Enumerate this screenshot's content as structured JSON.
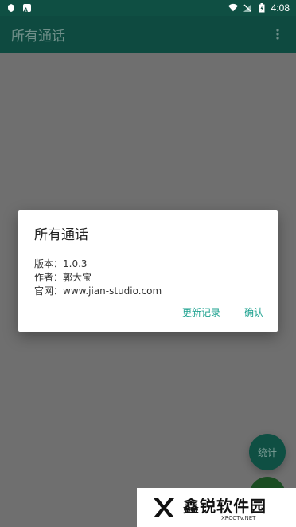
{
  "status_bar": {
    "time": "4:08",
    "left_icons": [
      "shield-icon",
      "a-icon"
    ],
    "right_icons": [
      "wifi-icon",
      "no-signal-icon",
      "battery-icon"
    ]
  },
  "app_bar": {
    "title": "所有通话",
    "menu_icon": "more-vert-icon"
  },
  "dialog": {
    "title": "所有通话",
    "version_line": "版本：1.0.3",
    "author_line": "作者：郭大宝",
    "website_line": "官网：www.jian-studio.com",
    "actions": {
      "changelog": "更新记录",
      "confirm": "确认"
    }
  },
  "fab": {
    "label": "统计"
  },
  "watermark": {
    "cn": "鑫锐软件园",
    "en": "XRCCTV.NET"
  },
  "colors": {
    "primary_dark": "#0f4f43",
    "accent": "#1aa08e",
    "scrim": "#6f6f6f"
  }
}
